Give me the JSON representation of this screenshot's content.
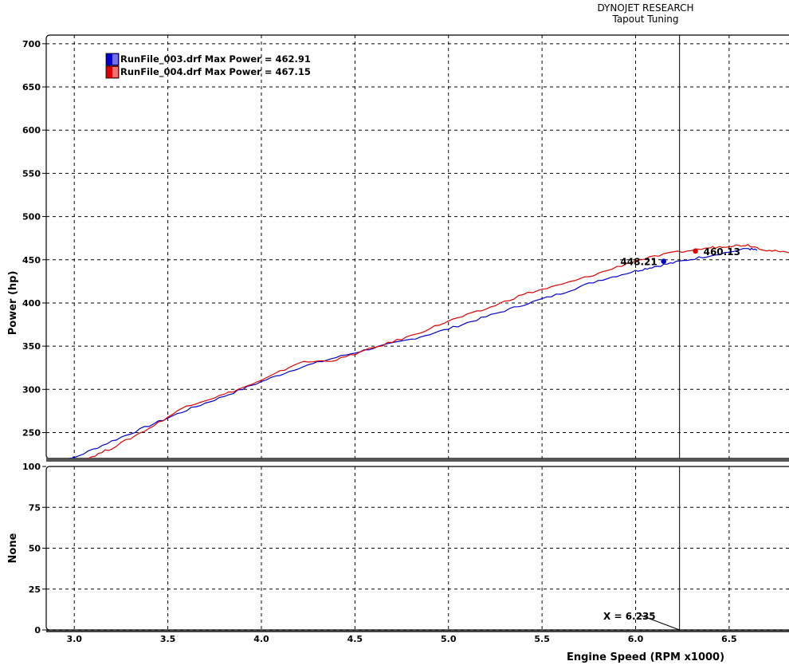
{
  "header": {
    "company": "DYNOJET RESEARCH",
    "shop": "Tapout Tuning"
  },
  "chart_data": [
    {
      "type": "line",
      "panel": "power",
      "xlabel": "Engine Speed (RPM x1000)",
      "ylabel": "Power (hp)",
      "xlim": [
        2.85,
        6.82
      ],
      "ylim": [
        220,
        710
      ],
      "x_ticks": [
        "3.0",
        "3.5",
        "4.0",
        "4.5",
        "5.0",
        "5.5",
        "6.0",
        "6.5"
      ],
      "y_ticks": [
        "700",
        "650",
        "600",
        "550",
        "500",
        "450",
        "400",
        "350",
        "300",
        "250"
      ],
      "grid": true,
      "legend_position": "top-left",
      "legend": [
        {
          "label": "RunFile_003.drf Max Power = 462.91",
          "color": "#0000cc"
        },
        {
          "label": "RunFile_004.drf Max Power = 467.15",
          "color": "#dd0000"
        }
      ],
      "series": [
        {
          "color": "#0000cc",
          "x": [
            2.95,
            3.0,
            3.2,
            3.4,
            3.6,
            3.8,
            4.0,
            4.2,
            4.4,
            4.6,
            4.8,
            5.0,
            5.2,
            5.4,
            5.6,
            5.8,
            6.0,
            6.1,
            6.235,
            6.4,
            6.6,
            6.65
          ],
          "y": [
            219,
            221,
            240,
            258,
            276,
            292,
            309,
            325,
            337,
            348,
            358,
            370,
            384,
            398,
            411,
            426,
            437,
            442,
            448,
            455,
            462.91,
            461
          ]
        },
        {
          "color": "#dd0000",
          "x": [
            3.06,
            3.2,
            3.4,
            3.6,
            3.8,
            4.0,
            4.2,
            4.4,
            4.6,
            4.8,
            5.0,
            5.2,
            5.4,
            5.6,
            5.8,
            6.0,
            6.2,
            6.4,
            6.5,
            6.6,
            6.7,
            6.82
          ],
          "y": [
            219,
            232,
            255,
            281,
            294,
            310,
            331,
            334,
            348,
            362,
            379,
            393,
            410,
            421,
            434,
            449,
            458,
            464,
            466,
            467.15,
            461,
            458
          ]
        }
      ],
      "cursor": {
        "x": 6.235,
        "label": "X = 6.235"
      },
      "markers": [
        {
          "x": 6.15,
          "y": 448.21,
          "label": "448.21",
          "color": "#0000cc"
        },
        {
          "x": 6.32,
          "y": 460.13,
          "label": "460.13",
          "color": "#dd0000"
        }
      ]
    },
    {
      "type": "line",
      "panel": "secondary",
      "ylabel": "None",
      "xlim": [
        2.85,
        6.82
      ],
      "ylim": [
        0,
        100
      ],
      "y_ticks": [
        "100",
        "75",
        "50",
        "25",
        "0"
      ],
      "grid": true,
      "series": []
    }
  ]
}
